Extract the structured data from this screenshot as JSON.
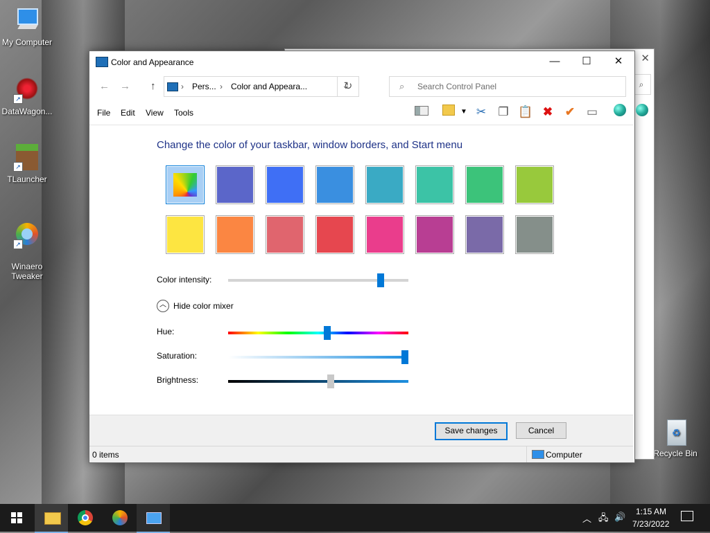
{
  "desktop": {
    "icons": [
      {
        "label": "My Computer"
      },
      {
        "label": "DataWagon..."
      },
      {
        "label": "TLauncher"
      },
      {
        "label": "Winaero\nTweaker"
      },
      {
        "label": "Recycle Bin"
      }
    ]
  },
  "window": {
    "title": "Color and Appearance",
    "breadcrumb": [
      "Pers...",
      "Color and Appeara..."
    ],
    "search_placeholder": "Search Control Panel",
    "menu": [
      "File",
      "Edit",
      "View",
      "Tools"
    ],
    "toolbar_icons": [
      "layout-icon",
      "new-folder-icon",
      "cut-icon",
      "copy-icon",
      "paste-icon",
      "delete-icon",
      "check-icon",
      "properties-icon",
      "globe-icon",
      "globe-alt-icon"
    ]
  },
  "content": {
    "heading": "Change the color of your taskbar, window borders, and Start menu",
    "swatches_row1": [
      "custom",
      "#5b66c9",
      "#3f6ff5",
      "#3a8fe0",
      "#3aaac4",
      "#3cc3a6",
      "#3cc37a",
      "#98c93c"
    ],
    "swatches_row2": [
      "#fde541",
      "#fb8642",
      "#e0656e",
      "#e6474f",
      "#ea3d8c",
      "#b83e93",
      "#7a6aa8",
      "#858f8a"
    ],
    "selected_swatch": 0,
    "color_intensity_label": "Color intensity:",
    "color_intensity_value": 0.86,
    "mixer_toggle_label": "Hide color mixer",
    "hue_label": "Hue:",
    "hue_value": 0.55,
    "saturation_label": "Saturation:",
    "saturation_value": 1.0,
    "brightness_label": "Brightness:",
    "brightness_value": 0.57,
    "accent_color": "#0078d7"
  },
  "footer": {
    "save_label": "Save changes",
    "cancel_label": "Cancel"
  },
  "statusbar": {
    "items": "0 items",
    "location": "Computer"
  },
  "taskbar": {
    "apps": [
      "file-explorer-icon",
      "chrome-icon",
      "winaero-icon",
      "control-panel-icon"
    ],
    "time": "1:15 AM",
    "date": "7/23/2022"
  }
}
